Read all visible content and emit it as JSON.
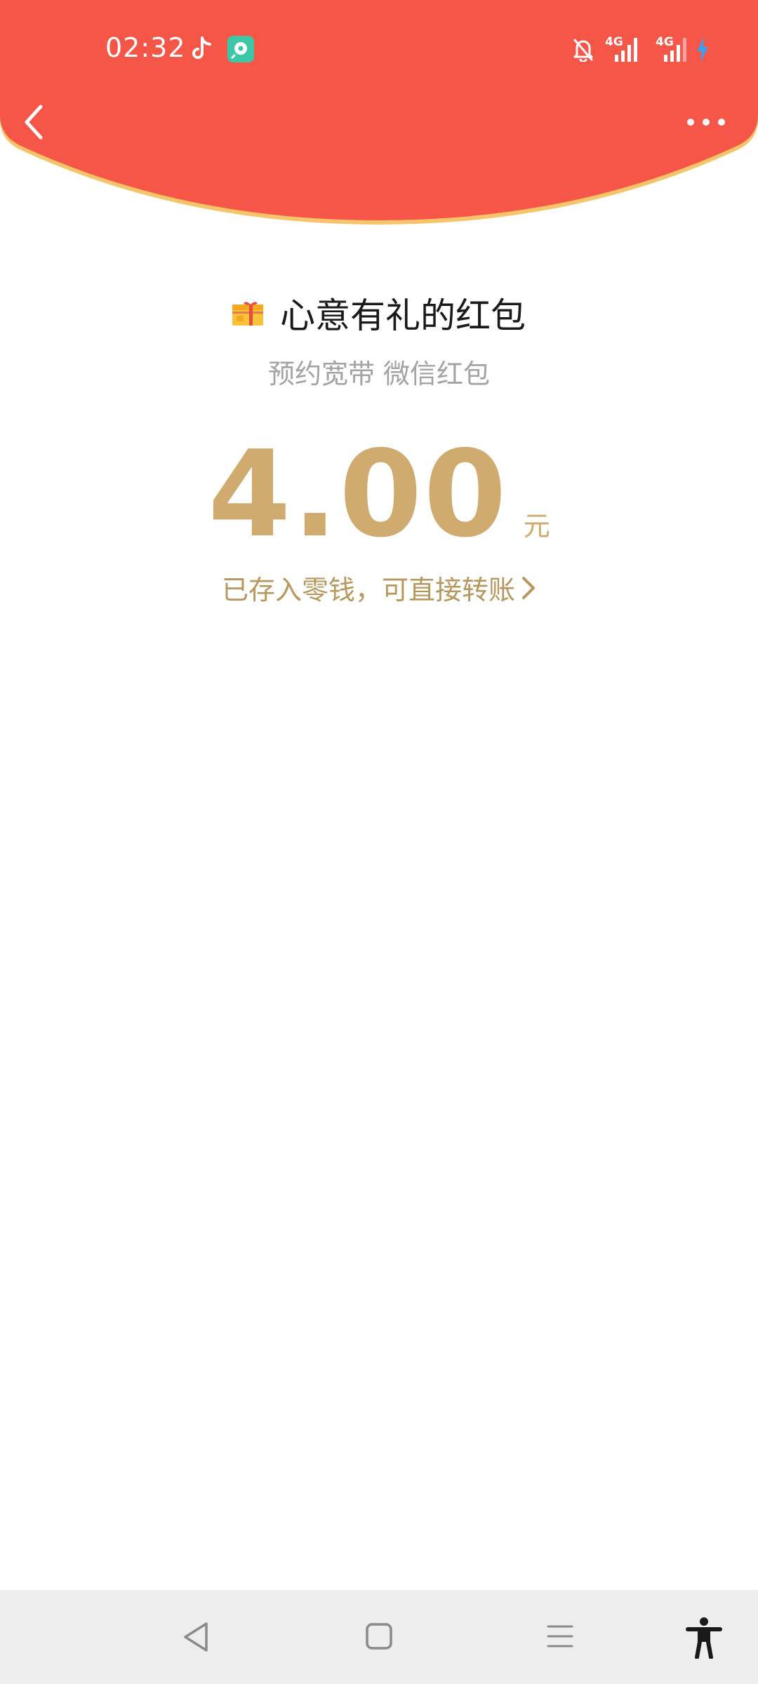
{
  "status_bar": {
    "time": "02:32",
    "left_icons": [
      "tiktok-icon",
      "screen-recorder-icon"
    ],
    "right_icons": [
      "mute-bell-icon",
      "signal-4g-icon",
      "signal-4g-icon",
      "charging-icon"
    ],
    "signal1_label": "4G",
    "signal2_label": "4G"
  },
  "colors": {
    "header_red": "#f55647",
    "header_edge": "#f7c46a",
    "gold": "#cfab6f",
    "subtitle_gray": "#a3a3a3"
  },
  "nav": {
    "back_icon": "chevron-left-icon",
    "more_icon": "more-dots-icon"
  },
  "red_packet": {
    "title": "心意有礼的红包",
    "subtitle": "预约宽带 微信红包",
    "amount": "4.00",
    "unit": "元",
    "stored_text": "已存入零钱，可直接转账"
  },
  "system_nav": {
    "buttons": [
      "back-triangle-icon",
      "home-square-icon",
      "recents-menu-icon",
      "accessibility-icon"
    ]
  }
}
